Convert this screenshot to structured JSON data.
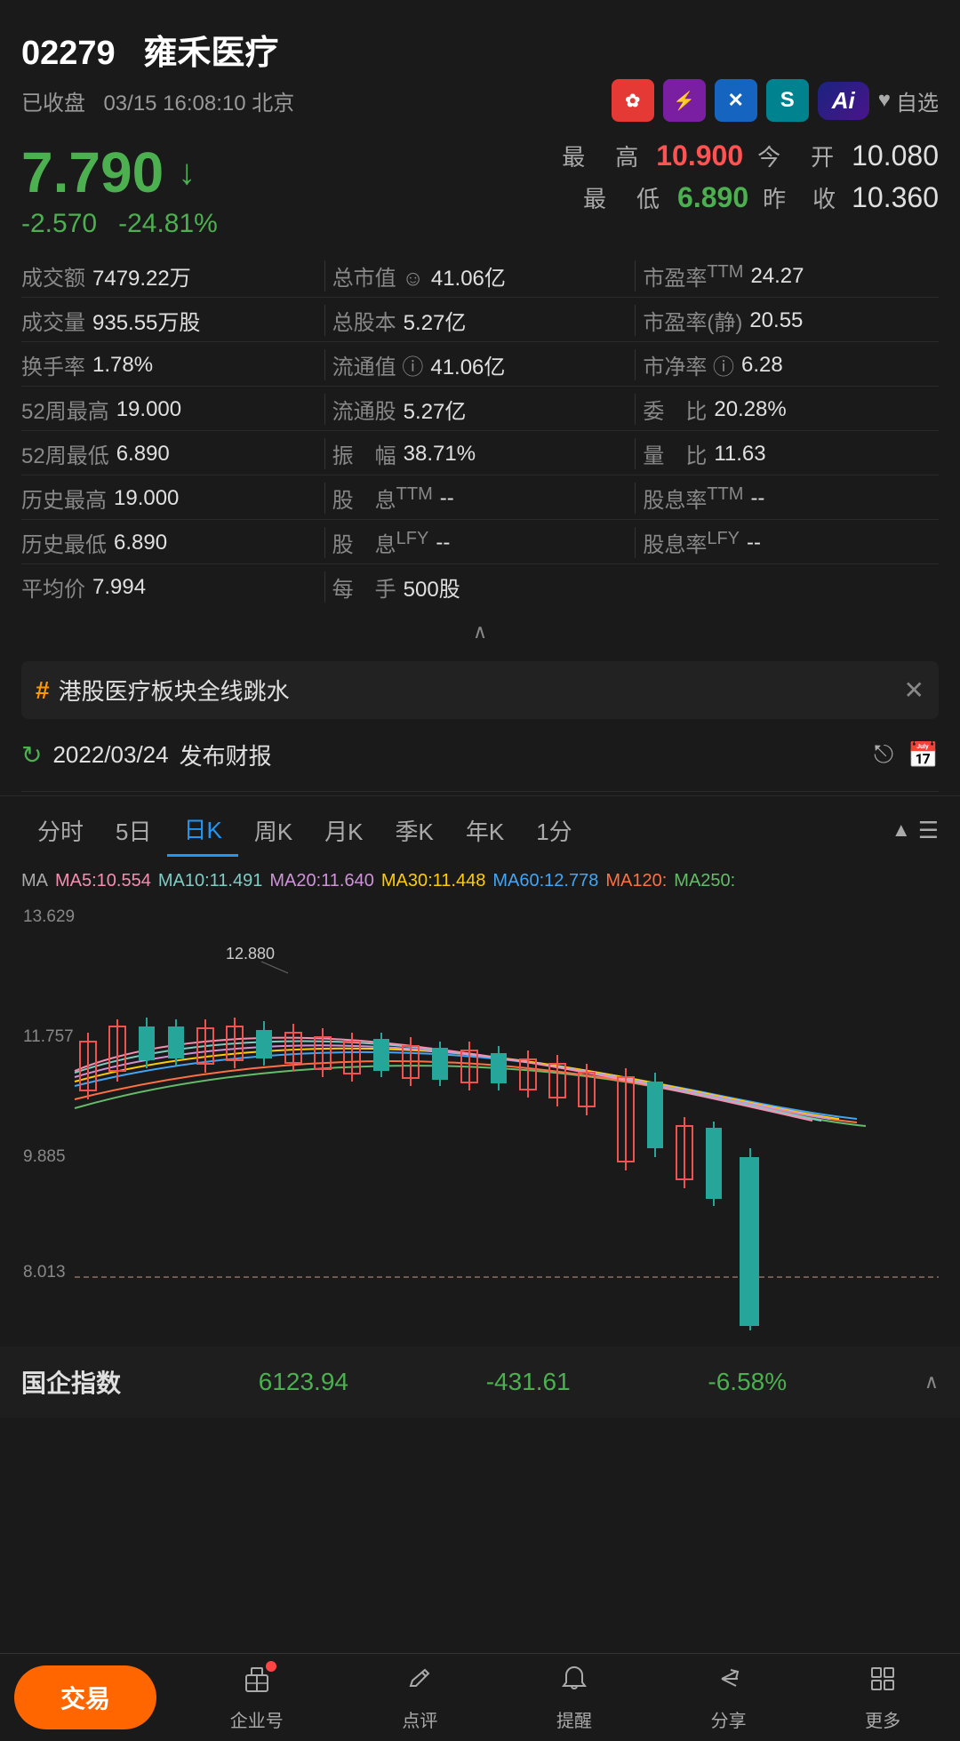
{
  "stock": {
    "code": "02279",
    "name": "雍禾医疗",
    "market_status": "已收盘",
    "datetime": "03/15 16:08:10 北京",
    "current_price": "7.790",
    "price_arrow": "↓",
    "change_abs": "-2.570",
    "change_pct": "-24.81%",
    "high_label": "最　高",
    "high_value": "10.900",
    "low_label": "最　低",
    "low_value": "6.890",
    "open_label": "今　开",
    "open_value": "10.080",
    "prev_label": "昨　收",
    "prev_value": "10.360"
  },
  "stats": [
    {
      "label": "成交额",
      "value": "7479.22万",
      "label2": "总市值",
      "value2": "41.06亿",
      "label3": "市盈率TTM",
      "value3": "24.27"
    },
    {
      "label": "成交量",
      "value": "935.55万股",
      "label2": "总股本",
      "value2": "5.27亿",
      "label3": "市盈率(静)",
      "value3": "20.55"
    },
    {
      "label": "换手率",
      "value": "1.78%",
      "label2": "流通值",
      "value2": "41.06亿",
      "label3": "市净率",
      "value3": "6.28"
    },
    {
      "label": "52周最高",
      "value": "19.000",
      "label2": "流通股",
      "value2": "5.27亿",
      "label3": "委　比",
      "value3": "20.28%"
    },
    {
      "label": "52周最低",
      "value": "6.890",
      "label2": "振　幅",
      "value2": "38.71%",
      "label3": "量　比",
      "value3": "11.63"
    },
    {
      "label": "历史最高",
      "value": "19.000",
      "label2": "股　息TTM",
      "value2": "--",
      "label3": "股息率TTM",
      "value3": "--"
    },
    {
      "label": "历史最低",
      "value": "6.890",
      "label2": "股　息LFY",
      "value2": "--",
      "label3": "股息率LFY",
      "value3": "--"
    },
    {
      "label": "平均价",
      "value": "7.994",
      "label2": "每　手",
      "value2": "500股",
      "label3": "",
      "value3": ""
    }
  ],
  "news": {
    "text": "港股医疗板块全线跳水"
  },
  "report": {
    "date": "2022/03/24",
    "text": "发布财报"
  },
  "chart_tabs": {
    "items": [
      "分时",
      "5日",
      "日K",
      "周K",
      "月K",
      "季K",
      "年K",
      "1分"
    ],
    "active": "日K"
  },
  "ma_legend": [
    {
      "label": "MA",
      "color": "#aaaaaa"
    },
    {
      "label": "MA5:10.554",
      "color": "#f48fb1"
    },
    {
      "label": "MA10:11.491",
      "color": "#80cbc4"
    },
    {
      "label": "MA20:11.640",
      "color": "#ce93d8"
    },
    {
      "label": "MA30:11.448",
      "color": "#ffcc02"
    },
    {
      "label": "MA60:12.778",
      "color": "#42a5f5"
    },
    {
      "label": "MA120:",
      "color": "#ff7043"
    },
    {
      "label": "MA250:",
      "color": "#66bb6a"
    }
  ],
  "chart": {
    "y_labels": [
      "13.629",
      "11.757",
      "9.885",
      "8.013"
    ],
    "label_12880": "12.880"
  },
  "index": {
    "name": "国企指数",
    "value": "6123.94",
    "change_abs": "-431.61",
    "change_pct": "-6.58%"
  },
  "bottom_nav": {
    "trade_label": "交易",
    "items": [
      {
        "label": "企业号",
        "icon": "🏢"
      },
      {
        "label": "点评",
        "icon": "✏️"
      },
      {
        "label": "提醒",
        "icon": "🔔"
      },
      {
        "label": "分享",
        "icon": "↗"
      },
      {
        "label": "更多",
        "icon": "⊞"
      }
    ]
  },
  "action_icons": [
    {
      "icon": "✿",
      "bg": "#e53935",
      "label": "flowers-icon"
    },
    {
      "icon": "⚡",
      "bg": "#7b1fa2",
      "label": "lightning-icon"
    },
    {
      "icon": "✕",
      "bg": "#1565c0",
      "label": "x-icon"
    },
    {
      "icon": "S",
      "bg": "#00838f",
      "label": "s-icon"
    }
  ],
  "ai_label": "Ai"
}
